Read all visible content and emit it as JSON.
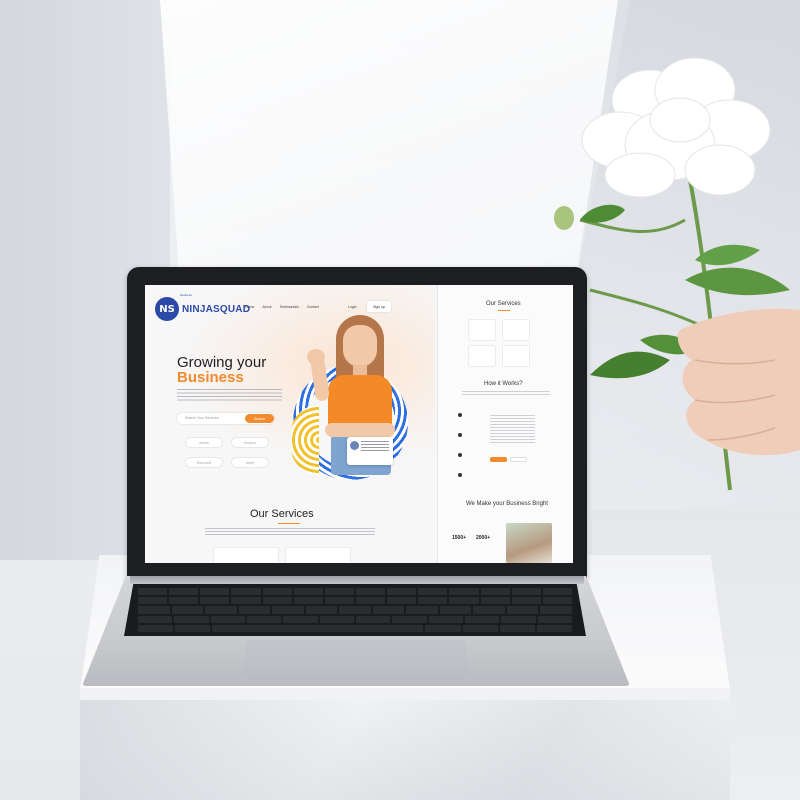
{
  "scene": {
    "description_colors": {
      "accent": "#f28a2e",
      "brand": "#2b4aa8",
      "hero_ring": "#2d6fe0"
    }
  },
  "website": {
    "logo": {
      "mark": "NS",
      "name": "NINJASQUAD",
      "sub": "business"
    },
    "nav": {
      "items": [
        "Home",
        "About",
        "Testimonials",
        "Contact"
      ],
      "login": "Login",
      "signup": "Sign up"
    },
    "hero": {
      "title_line1": "Growing your",
      "title_line2": "Business",
      "search_placeholder": "Search Your Services",
      "search_button": "Search",
      "brands": [
        "airbnb",
        "dropbox",
        "Microsoft",
        "stripe"
      ]
    },
    "services": {
      "title": "Our Services"
    },
    "right_page": {
      "services_title": "Our Services",
      "how_title": "How it Works?",
      "bright_title": "We Make your Business Bright",
      "stat1": "1500+",
      "stat2": "2000+"
    }
  }
}
